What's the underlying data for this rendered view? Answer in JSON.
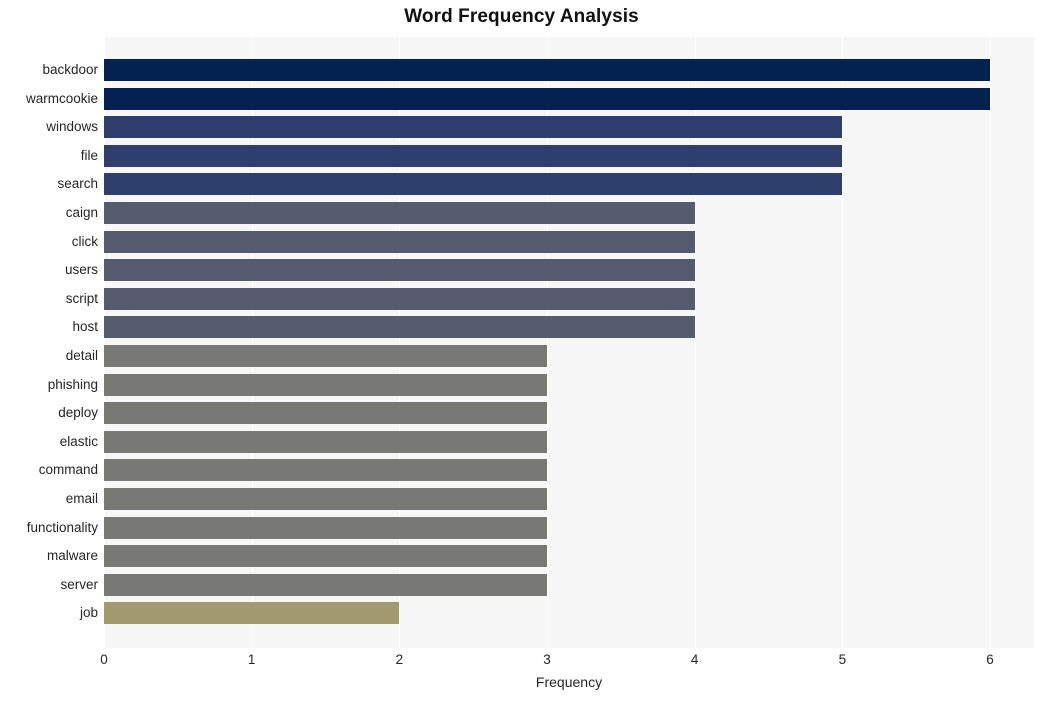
{
  "chart_data": {
    "type": "bar",
    "orientation": "horizontal",
    "title": "Word Frequency Analysis",
    "xlabel": "Frequency",
    "ylabel": "",
    "xlim": [
      0,
      6
    ],
    "ylim": null,
    "grid": true,
    "legend": false,
    "legend_position": "none",
    "x_ticks": [
      "0",
      "1",
      "2",
      "3",
      "4",
      "5",
      "6"
    ],
    "x_tick_values": [
      0,
      1,
      2,
      3,
      4,
      5,
      6
    ],
    "categories": [
      "backdoor",
      "warmcookie",
      "windows",
      "file",
      "search",
      "caign",
      "click",
      "users",
      "script",
      "host",
      "detail",
      "phishing",
      "deploy",
      "elastic",
      "command",
      "email",
      "functionality",
      "malware",
      "server",
      "job"
    ],
    "values": [
      6,
      6,
      5,
      5,
      5,
      4,
      4,
      4,
      4,
      4,
      3,
      3,
      3,
      3,
      3,
      3,
      3,
      3,
      3,
      2
    ],
    "bar_colors": [
      "#04224f",
      "#04224f",
      "#2e3f6e",
      "#2e3f6e",
      "#2e3f6e",
      "#565c70",
      "#565c70",
      "#565c70",
      "#565c70",
      "#565c70",
      "#787874",
      "#787874",
      "#787874",
      "#787874",
      "#787874",
      "#787874",
      "#787874",
      "#787874",
      "#787874",
      "#a39b70"
    ]
  },
  "style": {
    "plot_background": "#f7f7f7",
    "figure_background": "#ffffff",
    "gridline_color": "#ffffff",
    "text_color": "#262626",
    "title_color": "#111111"
  }
}
